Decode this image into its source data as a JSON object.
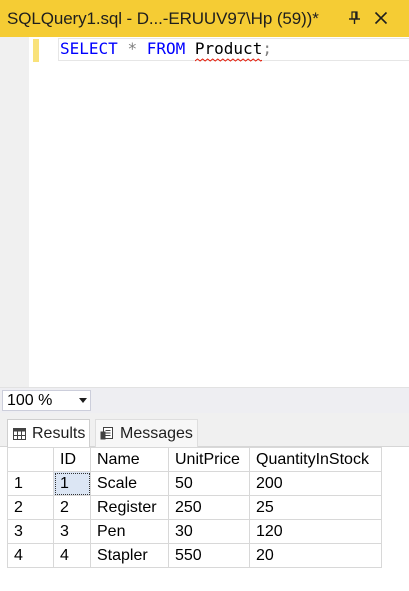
{
  "tab": {
    "title": "SQLQuery1.sql - D...-ERUUV97\\Hp (59))*",
    "pin_icon": "pin-icon",
    "close_icon": "close-icon",
    "accent": "#f5cc34"
  },
  "editor": {
    "keyword_select": "SELECT",
    "star": "*",
    "keyword_from": "FROM",
    "table_name": "Product",
    "terminator": ";",
    "keyword_color": "#0000ff",
    "squiggle_color": "#e51400"
  },
  "zoom": {
    "value": "100 %"
  },
  "results_tabs": {
    "results_label": "Results",
    "messages_label": "Messages"
  },
  "grid": {
    "columns": [
      "",
      "ID",
      "Name",
      "UnitPrice",
      "QuantityInStock"
    ],
    "rows": [
      [
        "1",
        "1",
        "Scale",
        "50",
        "200"
      ],
      [
        "2",
        "2",
        "Register",
        "250",
        "25"
      ],
      [
        "3",
        "3",
        "Pen",
        "30",
        "120"
      ],
      [
        "4",
        "4",
        "Stapler",
        "550",
        "20"
      ]
    ]
  }
}
